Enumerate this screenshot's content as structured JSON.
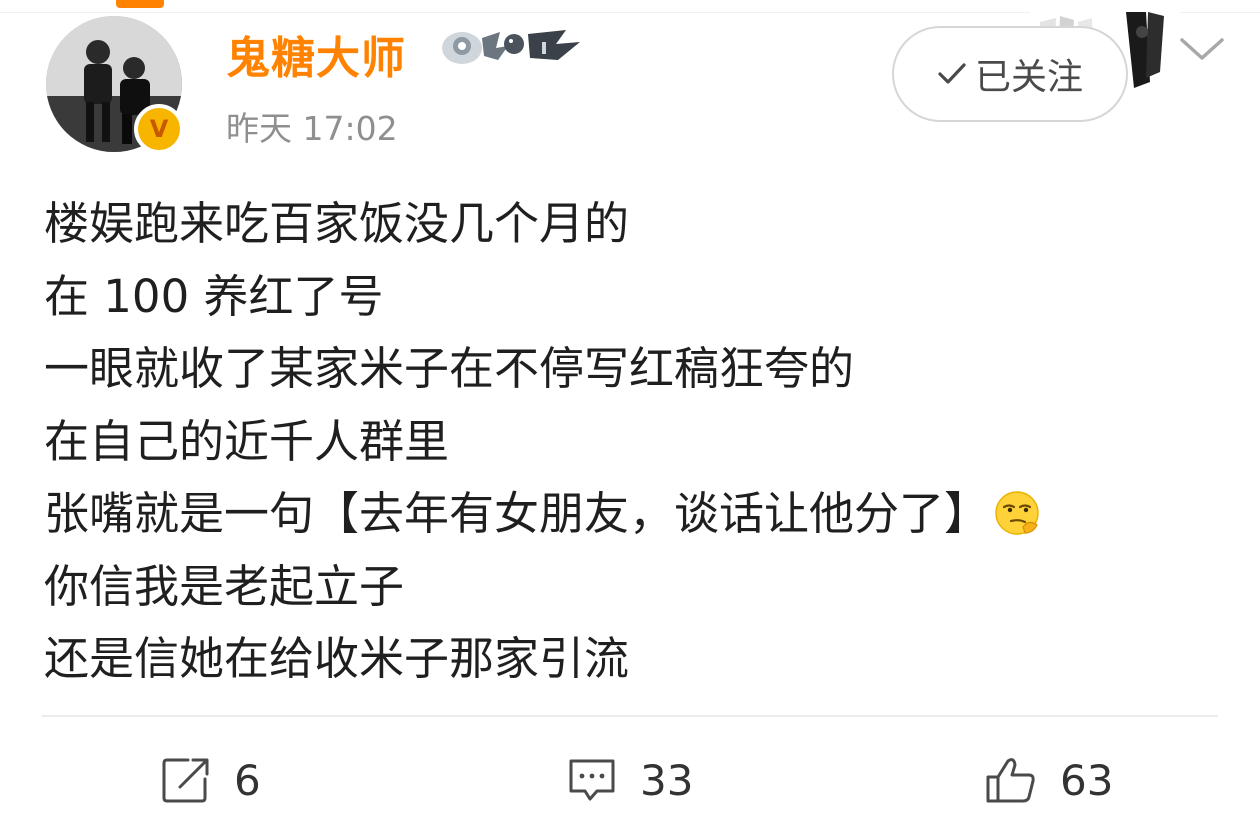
{
  "post": {
    "author": "鬼糖大师",
    "timestamp": "昨天 17:02",
    "follow_label": "已关注",
    "lines": [
      "楼娱跑来吃百家饭没几个月的",
      "在 100 养红了号",
      "一眼就收了某家米子在不停写红稿狂夸的",
      "在自己的近千人群里",
      "张嘴就是一句【去年有女朋友，谈话让他分了】",
      "你信我是老起立子",
      "还是信她在给收米子那家引流"
    ],
    "inline_emoji": "smirk-emoji"
  },
  "actions": {
    "repost_count": "6",
    "comment_count": "33",
    "like_count": "63"
  },
  "colors": {
    "username": "#ff8200",
    "timestamp": "#8f8f8f",
    "verified_badge": "#f7b500",
    "text": "#1f1f1f"
  },
  "icons": [
    "verified-badge-icon",
    "check-icon",
    "chevron-down-icon",
    "repost-icon",
    "comment-icon",
    "like-icon",
    "smirk-emoji"
  ]
}
